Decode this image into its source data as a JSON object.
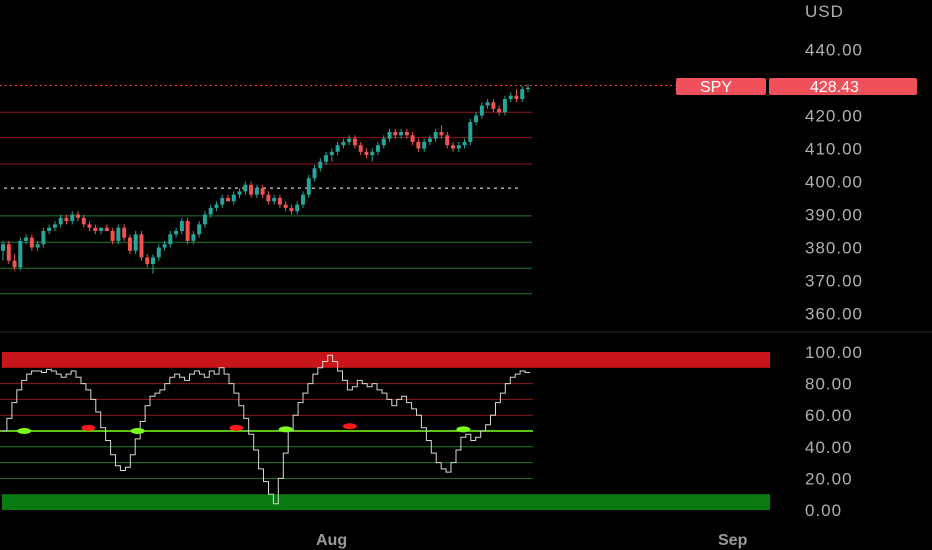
{
  "chart_data": [
    {
      "type": "candlestick",
      "symbol": "SPY",
      "currency_label": "USD",
      "last_price": "428.43",
      "ylim": [
        355,
        455
      ],
      "y_ticks": [
        "440.00",
        "420.00",
        "410.00",
        "400.00",
        "390.00",
        "380.00",
        "370.00",
        "360.00"
      ],
      "x_labels": [
        "Aug",
        "Sep"
      ],
      "colors": {
        "up": "#26a69a",
        "down": "#ef5350",
        "price_tag": "#f0505a"
      },
      "horizontal_levels": [
        {
          "value": 429.1,
          "color": "#ff3333",
          "style": "dotted-extend"
        },
        {
          "value": 421.0,
          "color": "#8b1a1a"
        },
        {
          "value": 413.3,
          "color": "#8b1a1a"
        },
        {
          "value": 405.3,
          "color": "#8b1a1a"
        },
        {
          "value": 398.0,
          "color": "#ffffff",
          "style": "dotted"
        },
        {
          "value": 389.6,
          "color": "#1f7a2a"
        },
        {
          "value": 381.6,
          "color": "#1f7a2a"
        },
        {
          "value": 373.7,
          "color": "#1f7a2a"
        },
        {
          "value": 366.0,
          "color": "#1f7a2a"
        }
      ],
      "ohlc": [
        [
          379,
          382,
          376,
          381
        ],
        [
          381,
          382,
          375,
          376
        ],
        [
          376,
          378,
          373,
          374
        ],
        [
          374,
          383,
          373,
          382
        ],
        [
          382,
          384,
          381,
          383
        ],
        [
          383,
          384,
          379,
          380
        ],
        [
          380,
          382,
          379,
          381
        ],
        [
          381,
          386,
          380,
          385
        ],
        [
          385,
          387,
          384,
          386
        ],
        [
          386,
          388,
          385,
          387
        ],
        [
          387,
          390,
          386,
          389
        ],
        [
          389,
          390,
          387,
          388
        ],
        [
          388,
          391,
          387,
          390
        ],
        [
          390,
          391,
          388,
          389
        ],
        [
          389,
          390,
          386,
          387
        ],
        [
          387,
          388,
          385,
          386
        ],
        [
          386,
          387,
          384,
          385
        ],
        [
          385,
          386,
          384,
          386
        ],
        [
          386,
          387,
          385,
          385
        ],
        [
          385,
          386,
          381,
          382
        ],
        [
          382,
          387,
          381,
          386
        ],
        [
          386,
          387,
          382,
          383
        ],
        [
          383,
          384,
          378,
          379
        ],
        [
          379,
          385,
          378,
          384
        ],
        [
          384,
          385,
          376,
          377
        ],
        [
          377,
          378,
          374,
          375
        ],
        [
          375,
          378,
          372,
          377
        ],
        [
          377,
          381,
          376,
          380
        ],
        [
          380,
          382,
          379,
          381
        ],
        [
          381,
          385,
          380,
          384
        ],
        [
          384,
          386,
          383,
          385
        ],
        [
          385,
          389,
          384,
          388
        ],
        [
          388,
          389,
          381,
          382
        ],
        [
          382,
          385,
          381,
          384
        ],
        [
          384,
          388,
          383,
          387
        ],
        [
          387,
          391,
          386,
          390
        ],
        [
          390,
          393,
          389,
          392
        ],
        [
          392,
          394,
          391,
          393
        ],
        [
          393,
          396,
          392,
          395
        ],
        [
          395,
          396,
          394,
          394
        ],
        [
          394,
          397,
          393,
          396
        ],
        [
          396,
          398,
          395,
          397
        ],
        [
          397,
          400,
          396,
          399
        ],
        [
          399,
          400,
          395,
          396
        ],
        [
          396,
          399,
          395,
          398
        ],
        [
          398,
          399,
          395,
          396
        ],
        [
          396,
          397,
          393,
          394
        ],
        [
          394,
          396,
          393,
          395
        ],
        [
          395,
          396,
          392,
          393
        ],
        [
          393,
          394,
          391,
          392
        ],
        [
          392,
          393,
          390,
          391
        ],
        [
          391,
          394,
          390,
          393
        ],
        [
          393,
          397,
          392,
          396
        ],
        [
          396,
          402,
          395,
          401
        ],
        [
          401,
          405,
          400,
          404
        ],
        [
          404,
          407,
          403,
          406
        ],
        [
          406,
          409,
          405,
          408
        ],
        [
          408,
          410,
          406,
          409
        ],
        [
          409,
          412,
          408,
          411
        ],
        [
          411,
          413,
          410,
          412
        ],
        [
          412,
          414,
          411,
          413
        ],
        [
          413,
          414,
          410,
          411
        ],
        [
          411,
          412,
          408,
          409
        ],
        [
          409,
          410,
          407,
          408
        ],
        [
          408,
          410,
          406,
          409
        ],
        [
          409,
          412,
          408,
          411
        ],
        [
          411,
          414,
          410,
          413
        ],
        [
          413,
          416,
          412,
          415
        ],
        [
          415,
          416,
          413,
          414
        ],
        [
          414,
          416,
          413,
          415
        ],
        [
          415,
          416,
          413,
          414
        ],
        [
          414,
          415,
          411,
          412
        ],
        [
          412,
          413,
          409,
          410
        ],
        [
          410,
          413,
          409,
          412
        ],
        [
          412,
          414,
          411,
          413
        ],
        [
          413,
          416,
          412,
          415
        ],
        [
          415,
          417,
          413,
          414
        ],
        [
          414,
          415,
          410,
          411
        ],
        [
          411,
          412,
          409,
          410
        ],
        [
          410,
          412,
          409,
          411
        ],
        [
          411,
          413,
          410,
          412
        ],
        [
          412,
          419,
          411,
          418
        ],
        [
          418,
          421,
          417,
          420
        ],
        [
          420,
          424,
          419,
          423
        ],
        [
          423,
          425,
          422,
          424
        ],
        [
          424,
          425,
          421,
          422
        ],
        [
          422,
          423,
          420,
          421
        ],
        [
          421,
          426,
          420,
          425
        ],
        [
          425,
          427,
          424,
          426
        ],
        [
          426,
          428,
          424,
          425
        ],
        [
          425,
          429,
          424,
          428
        ],
        [
          428,
          429.5,
          427,
          428.43
        ]
      ]
    },
    {
      "type": "line",
      "name": "oscillator",
      "ylim": [
        0,
        100
      ],
      "y_ticks": [
        "100.00",
        "80.00",
        "60.00",
        "40.00",
        "20.00",
        "0.00"
      ],
      "zones": {
        "upper": [
          90,
          100
        ],
        "lower": [
          0,
          10
        ]
      },
      "upper_zone_color": "#c8151a",
      "lower_zone_color": "#087a10",
      "levels": [
        80,
        70,
        60,
        50,
        40,
        30,
        20
      ],
      "midline_color": "#7cff1a",
      "values": [
        50,
        58,
        68,
        76,
        82,
        86,
        88,
        88,
        87,
        89,
        88,
        86,
        84,
        86,
        88,
        84,
        80,
        76,
        70,
        62,
        52,
        44,
        35,
        28,
        25,
        27,
        35,
        45,
        56,
        66,
        72,
        74,
        76,
        80,
        84,
        86,
        84,
        82,
        86,
        88,
        86,
        84,
        88,
        86,
        90,
        86,
        80,
        74,
        66,
        58,
        48,
        38,
        26,
        18,
        10,
        4,
        20,
        36,
        50,
        60,
        68,
        74,
        80,
        86,
        90,
        94,
        98,
        94,
        88,
        82,
        76,
        78,
        82,
        80,
        78,
        80,
        76,
        74,
        70,
        66,
        70,
        72,
        68,
        64,
        60,
        52,
        44,
        36,
        30,
        26,
        24,
        30,
        38,
        46,
        48,
        44,
        46,
        50,
        54,
        60,
        68,
        74,
        80,
        84,
        86,
        88,
        87
      ],
      "markers": [
        {
          "index": 4,
          "value": 50,
          "color": "#7cff1a"
        },
        {
          "index": 17,
          "value": 52,
          "color": "#ff1a1a"
        },
        {
          "index": 27,
          "value": 50,
          "color": "#7cff1a"
        },
        {
          "index": 47,
          "value": 52,
          "color": "#ff1a1a"
        },
        {
          "index": 57,
          "value": 51,
          "color": "#7cff1a"
        },
        {
          "index": 70,
          "value": 53,
          "color": "#ff1a1a"
        },
        {
          "index": 93,
          "value": 51,
          "color": "#7cff1a"
        }
      ]
    }
  ]
}
